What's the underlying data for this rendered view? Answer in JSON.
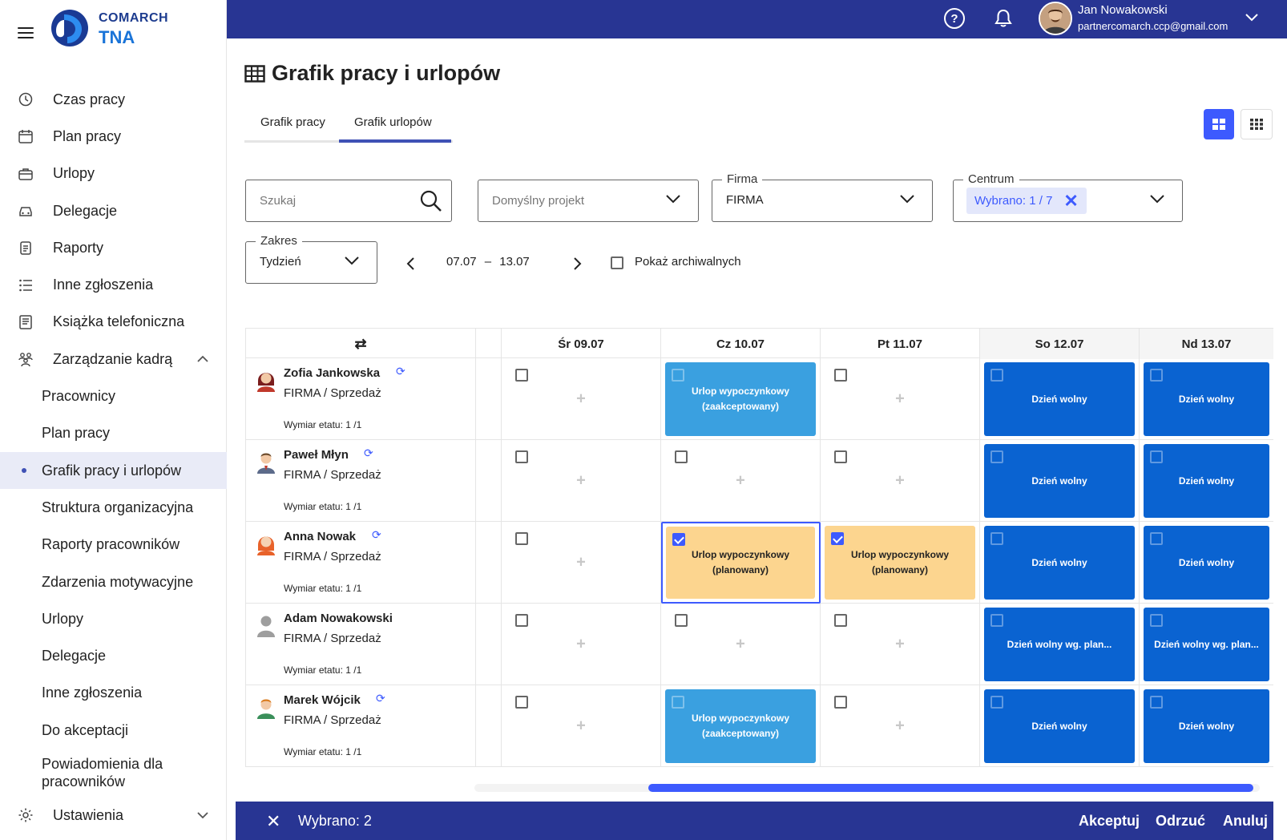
{
  "app": {
    "logo_line1": "COMARCH",
    "logo_line2": "TNA"
  },
  "user": {
    "name": "Jan Nowakowski",
    "email": "partnercomarch.ccp@gmail.com"
  },
  "header_icons": {
    "help": "?",
    "help_icon": "help-circle-icon",
    "bell_icon": "bell-icon"
  },
  "sidebar": {
    "items": [
      {
        "label": "Czas pracy",
        "icon": "clock-icon"
      },
      {
        "label": "Plan pracy",
        "icon": "calendar-icon"
      },
      {
        "label": "Urlopy",
        "icon": "suitcase-icon"
      },
      {
        "label": "Delegacje",
        "icon": "car-icon"
      },
      {
        "label": "Raporty",
        "icon": "clipboard-icon"
      },
      {
        "label": "Inne zgłoszenia",
        "icon": "list-icon"
      },
      {
        "label": "Książka telefoniczna",
        "icon": "book-icon"
      },
      {
        "label": "Zarządzanie kadrą",
        "icon": "team-icon"
      }
    ],
    "subitems": [
      "Pracownicy",
      "Plan pracy",
      "Grafik pracy i urlopów",
      "Struktura organizacyjna",
      "Raporty pracowników",
      "Zdarzenia motywacyjne",
      "Urlopy",
      "Delegacje",
      "Inne zgłoszenia",
      "Do akceptacji",
      "Powiadomienia dla pracowników"
    ],
    "active_subitem": "Grafik pracy i urlopów",
    "settings_label": "Ustawienia"
  },
  "page": {
    "title": "Grafik pracy i urlopów",
    "tabs": [
      {
        "label": "Grafik pracy"
      },
      {
        "label": "Grafik urlopów"
      }
    ],
    "active_tab": "Grafik urlopów"
  },
  "filters": {
    "search_placeholder": "Szukaj",
    "project_placeholder": "Domyślny projekt",
    "firma_label": "Firma",
    "firma_value": "FIRMA",
    "centrum_label": "Centrum",
    "centrum_chip": "Wybrano: 1 / 7",
    "zakres_label": "Zakres",
    "zakres_value": "Tydzień",
    "date_from": "07.07",
    "date_sep": "–",
    "date_to": "13.07",
    "archived_label": "Pokaż archiwalnych",
    "archived_checked": false
  },
  "grid": {
    "swap_icon": "⇄",
    "days": [
      {
        "label": "Śr 09.07",
        "weekend": false
      },
      {
        "label": "Cz 10.07",
        "weekend": false
      },
      {
        "label": "Pt 11.07",
        "weekend": false
      },
      {
        "label": "So 12.07",
        "weekend": true
      },
      {
        "label": "Nd 13.07",
        "weekend": true
      }
    ],
    "employees": [
      {
        "name": "Zofia Jankowska",
        "company": "FIRMA / Sprzedaż",
        "etat": "Wymiar etatu: 1 /1",
        "sync": true,
        "avatar": "woman-dark-hair-avatar",
        "cells": [
          {
            "type": "empty",
            "checked": false
          },
          {
            "type": "accepted",
            "text1": "Urlop wypoczynkowy",
            "text2": "(zaakceptowany)"
          },
          {
            "type": "empty",
            "checked": false
          },
          {
            "type": "off",
            "text1": "Dzień wolny"
          },
          {
            "type": "off",
            "text1": "Dzień wolny"
          }
        ]
      },
      {
        "name": "Paweł Młyn",
        "company": "FIRMA / Sprzedaż",
        "etat": "Wymiar etatu: 1 /1",
        "sync": true,
        "avatar": "man-suit-avatar",
        "cells": [
          {
            "type": "empty",
            "checked": false
          },
          {
            "type": "empty",
            "checked": false
          },
          {
            "type": "empty",
            "checked": false
          },
          {
            "type": "off",
            "text1": "Dzień wolny"
          },
          {
            "type": "off",
            "text1": "Dzień wolny"
          }
        ]
      },
      {
        "name": "Anna Nowak",
        "company": "FIRMA / Sprzedaż",
        "etat": "Wymiar etatu: 1 /1",
        "sync": true,
        "avatar": "woman-red-hair-avatar",
        "cells": [
          {
            "type": "empty",
            "checked": false
          },
          {
            "type": "planned",
            "text1": "Urlop wypoczynkowy",
            "text2": "(planowany)",
            "checked": true,
            "selected": true
          },
          {
            "type": "planned",
            "text1": "Urlop wypoczynkowy",
            "text2": "(planowany)",
            "checked": true
          },
          {
            "type": "off",
            "text1": "Dzień wolny"
          },
          {
            "type": "off",
            "text1": "Dzień wolny"
          }
        ]
      },
      {
        "name": "Adam Nowakowski",
        "company": "FIRMA / Sprzedaż",
        "etat": "Wymiar etatu: 1 /1",
        "sync": false,
        "avatar": "default-person-avatar",
        "cells": [
          {
            "type": "empty",
            "checked": false
          },
          {
            "type": "empty",
            "checked": false
          },
          {
            "type": "empty",
            "checked": false
          },
          {
            "type": "off",
            "text1": "Dzień wolny wg. plan..."
          },
          {
            "type": "off",
            "text1": "Dzień wolny wg. plan..."
          }
        ]
      },
      {
        "name": "Marek Wójcik",
        "company": "FIRMA / Sprzedaż",
        "etat": "Wymiar etatu: 1 /1",
        "sync": true,
        "avatar": "man-avatar",
        "cells": [
          {
            "type": "empty",
            "checked": false
          },
          {
            "type": "accepted",
            "text1": "Urlop wypoczynkowy",
            "text2": "(zaakceptowany)"
          },
          {
            "type": "empty",
            "checked": false
          },
          {
            "type": "off",
            "text1": "Dzień wolny"
          },
          {
            "type": "off",
            "text1": "Dzień wolny"
          }
        ]
      }
    ]
  },
  "actionbar": {
    "selected_text": "Wybrano: 2",
    "accept": "Akceptuj",
    "reject": "Odrzuć",
    "cancel": "Anuluj"
  },
  "colors": {
    "brand": "#283593",
    "accent": "#3d5afe",
    "day_off": "#0a63d1",
    "accepted": "#3aa0e0",
    "planned": "#fcd58f"
  }
}
